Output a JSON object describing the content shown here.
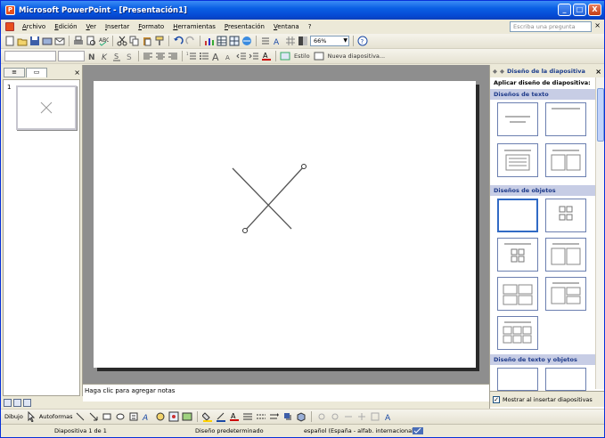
{
  "window": {
    "title": "Microsoft PowerPoint - [Presentación1]",
    "buttons": [
      "_",
      "□",
      "X"
    ]
  },
  "menu": {
    "items": [
      "Archivo",
      "Edición",
      "Ver",
      "Insertar",
      "Formato",
      "Herramientas",
      "Presentación",
      "Ventana",
      "?"
    ],
    "help_placeholder": "Escriba una pregunta",
    "close_symbol": "×"
  },
  "toolbar": {
    "zoom": "66%",
    "help_symbol": "?",
    "design_label": "Estilo",
    "new_slide_label": "Nueva diapositiva..."
  },
  "left_pane": {
    "tabs": [
      "≡",
      "▭"
    ],
    "close_symbol": "×",
    "slide_number": "1"
  },
  "notes": {
    "placeholder": "Haga clic para agregar notas"
  },
  "task_pane": {
    "title": "Diseño de la diapositiva",
    "apply_label": "Aplicar diseño de diapositiva:",
    "sections": [
      "Diseños de texto",
      "Diseños de objetos",
      "Diseño de texto y objetos"
    ],
    "show_checkbox_label": "Mostrar al insertar diapositivas",
    "show_checkbox_checked": true,
    "nav_symbols": [
      "◆",
      "◆"
    ],
    "close_symbol": "×"
  },
  "draw_toolbar": {
    "draw_label": "Dibujo",
    "autoshapes_label": "Autoformas"
  },
  "status": {
    "slide": "Diapositiva 1 de 1",
    "design": "Diseño predeterminado",
    "language": "español (España - alfab. internacional)"
  }
}
